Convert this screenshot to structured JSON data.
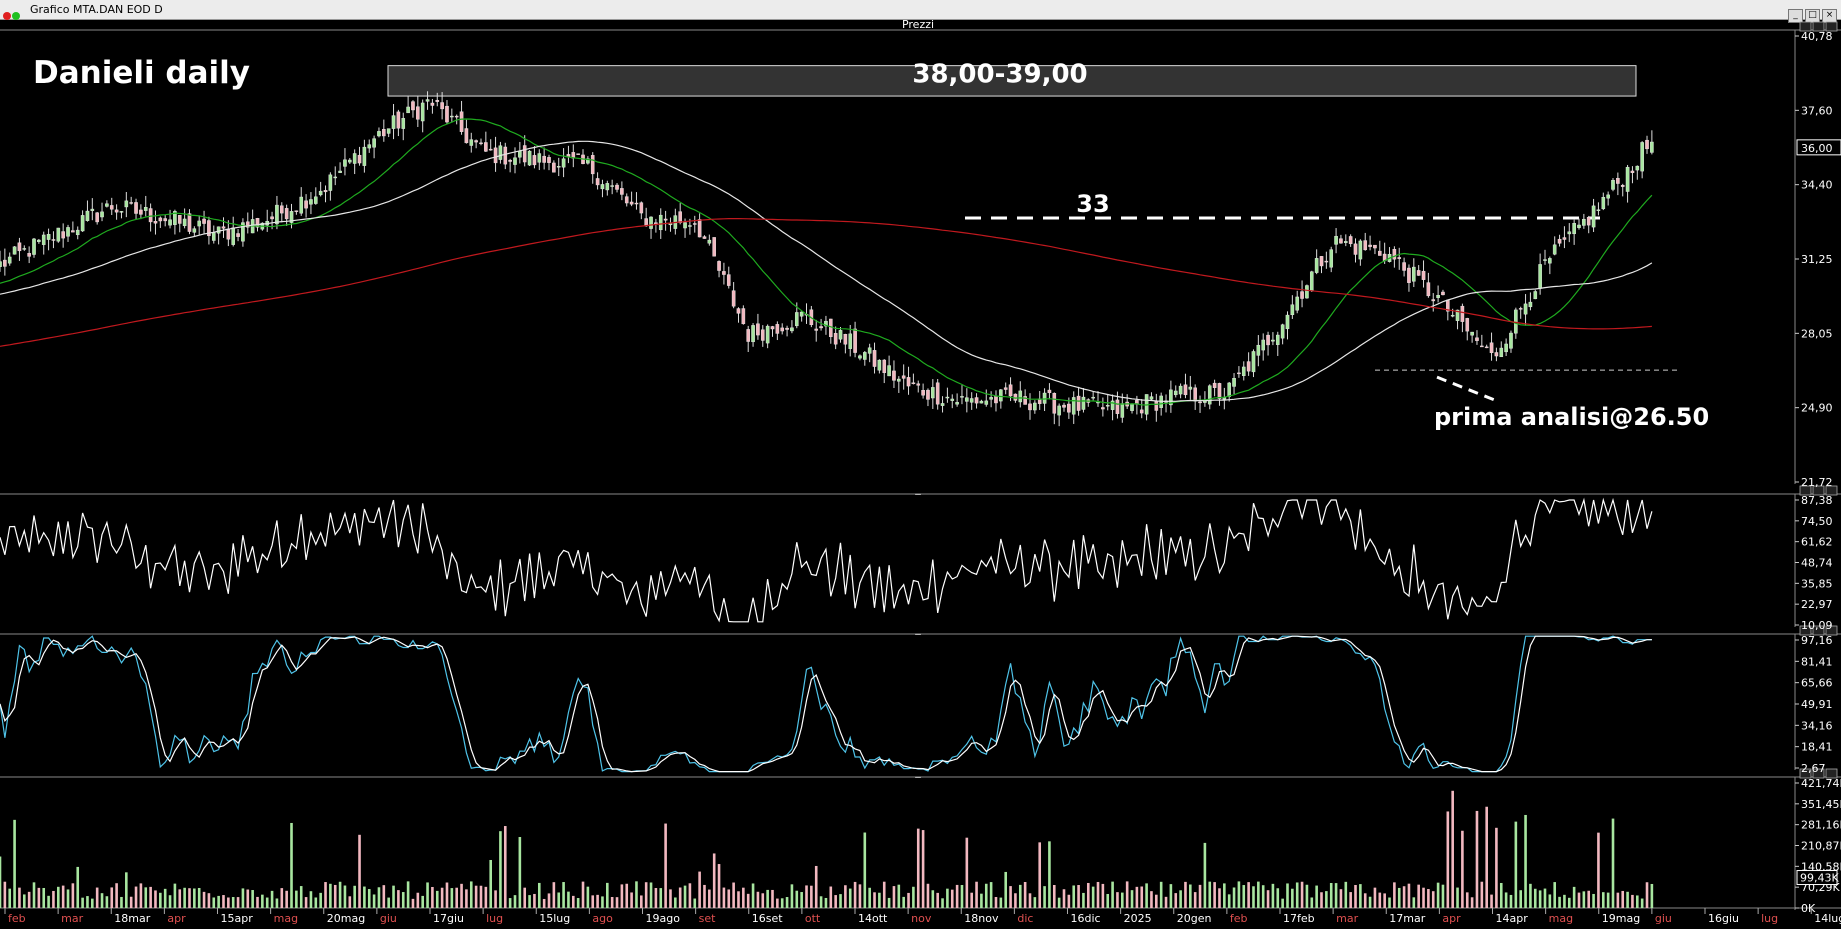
{
  "window": {
    "title": "Grafico MTA.DAN EOD D",
    "buttons": [
      "_",
      "□",
      "×"
    ]
  },
  "colors": {
    "background": "#000000",
    "price_line": "#ffffff",
    "sma_fast": "#1faa1f",
    "sma_mid": "#e6e6e6",
    "sma_slow": "#c0191e",
    "rsi_line": "#ffffff",
    "stoch_k": "#4fc3e8",
    "stoch_d": "#ffffff",
    "volume_up": "#a8e6a0",
    "volume_down": "#f2b8c0",
    "zone_fill": "#333333"
  },
  "chart_data": [
    {
      "type": "candlestick",
      "panel_label": "Prezzi",
      "title": "Danieli daily",
      "ylim": [
        21.72,
        40.78
      ],
      "y_ticks": [
        "40,78",
        "37,60",
        "34,40",
        "31,25",
        "28,05",
        "24,90",
        "21,72"
      ],
      "last_price_label": "36,00",
      "x_tick_labels": [
        "feb",
        "mar",
        "18mar",
        "apr",
        "15apr",
        "mag",
        "20mag",
        "giu",
        "17giu",
        "lug",
        "15lug",
        "ago",
        "19ago",
        "set",
        "16set",
        "ott",
        "14ott",
        "nov",
        "18nov",
        "dic",
        "16dic",
        "2025",
        "20gen",
        "feb",
        "17feb",
        "mar",
        "17mar",
        "apr",
        "14apr",
        "mag",
        "19mag",
        "giu",
        "16giu",
        "lug",
        "14lug"
      ],
      "approx_close_path": [
        {
          "x": "feb",
          "y": 31.0
        },
        {
          "x": "18mar",
          "y": 33.5
        },
        {
          "x": "apr",
          "y": 33.0
        },
        {
          "x": "15apr",
          "y": 32.3
        },
        {
          "x": "mag",
          "y": 33.0
        },
        {
          "x": "20mag",
          "y": 34.3
        },
        {
          "x": "giu",
          "y": 36.5
        },
        {
          "x": "17giu",
          "y": 38.0
        },
        {
          "x": "lug",
          "y": 35.8
        },
        {
          "x": "15lug",
          "y": 35.5
        },
        {
          "x": "ago",
          "y": 35.2
        },
        {
          "x": "19ago",
          "y": 33.0
        },
        {
          "x": "set",
          "y": 32.9
        },
        {
          "x": "16set",
          "y": 28.0
        },
        {
          "x": "ott",
          "y": 28.8
        },
        {
          "x": "14ott",
          "y": 27.5
        },
        {
          "x": "nov",
          "y": 25.8
        },
        {
          "x": "18nov",
          "y": 25.2
        },
        {
          "x": "dic",
          "y": 25.3
        },
        {
          "x": "16dic",
          "y": 25.0
        },
        {
          "x": "2025",
          "y": 24.8
        },
        {
          "x": "20gen",
          "y": 25.4
        },
        {
          "x": "feb",
          "y": 25.5
        },
        {
          "x": "17feb",
          "y": 28.5
        },
        {
          "x": "mar",
          "y": 32.0
        },
        {
          "x": "17mar",
          "y": 31.5
        },
        {
          "x": "apr",
          "y": 29.5
        },
        {
          "x": "14apr",
          "y": 27.0
        },
        {
          "x": "mag",
          "y": 31.0
        },
        {
          "x": "19mag",
          "y": 33.5
        },
        {
          "x": "giu",
          "y": 36.3
        }
      ],
      "annotations": {
        "resistance_zone_label": "38,00-39,00",
        "zone_range": [
          38.0,
          39.0
        ],
        "level_33_label": "33",
        "level_33": 33.0,
        "support_level": 26.5,
        "analysis_label": "prima analisi@26.50"
      },
      "series": [
        {
          "role": "sma_fast"
        },
        {
          "role": "sma_mid"
        },
        {
          "role": "sma_slow"
        }
      ]
    },
    {
      "type": "line",
      "panel_label": "_",
      "ylim": [
        10.09,
        87.38
      ],
      "y_ticks": [
        "87,38",
        "74,50",
        "61,62",
        "48,74",
        "35,85",
        "22,97",
        "10,09"
      ]
    },
    {
      "type": "line",
      "panel_label": "_",
      "ylim": [
        2.67,
        97.16
      ],
      "y_ticks": [
        "97,16",
        "81,41",
        "65,66",
        "49,91",
        "34,16",
        "18,41",
        "2,67"
      ]
    },
    {
      "type": "bar",
      "panel_label": "_",
      "ylim": [
        0,
        421.74
      ],
      "y_ticks": [
        "421,74K",
        "351,45K",
        "281,16K",
        "210,87K",
        "140,58K",
        "70,29K",
        "0K"
      ],
      "last_volume_label": "99,43K"
    }
  ]
}
